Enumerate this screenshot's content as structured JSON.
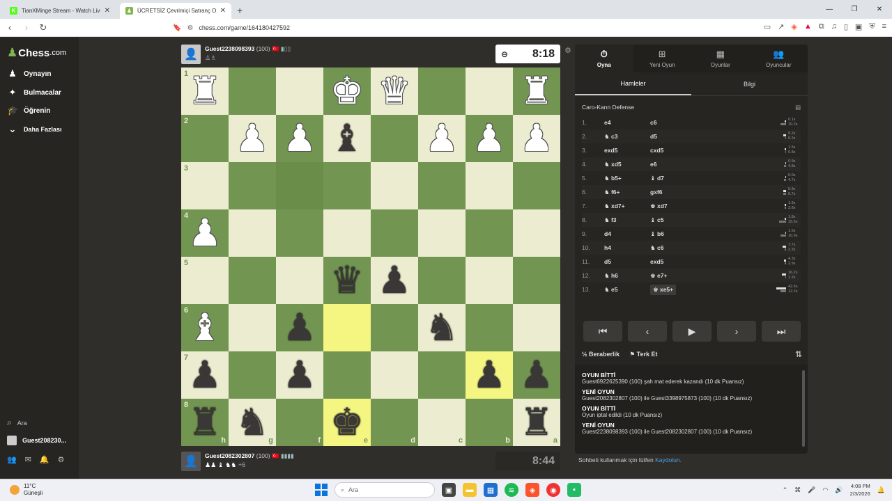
{
  "browser": {
    "tabs": [
      {
        "title": "TianXMinge Stream - Watch Live on",
        "favicon_color": "#53fc18",
        "favicon_letter": "K",
        "active": false
      },
      {
        "title": "ÜCRETSİZ Çevrimiçi Satranç Oyna",
        "favicon_color": "#81b64c",
        "favicon_letter": "♟",
        "active": true
      }
    ],
    "new_tab": "+",
    "url": "chess.com/game/164180427592"
  },
  "sidebar": {
    "logo": "Chess",
    "logo_suffix": ".com",
    "items": [
      {
        "label": "Oynayın",
        "icon": "play-icon",
        "glyph": "♟"
      },
      {
        "label": "Bulmacalar",
        "icon": "puzzle-icon",
        "glyph": "✦"
      },
      {
        "label": "Öğrenin",
        "icon": "learn-icon",
        "glyph": "🎓"
      },
      {
        "label": "Daha Fazlası",
        "icon": "chevron-down-icon",
        "glyph": "⌄"
      }
    ],
    "search_label": "Ara",
    "user_label": "Guest208230..."
  },
  "top_player": {
    "name": "Guest2238098393",
    "rating": "(100)",
    "clock": "8:18"
  },
  "bottom_player": {
    "name": "Guest2082302807",
    "rating": "(100)",
    "captures_extra": "+6",
    "clock": "8:44"
  },
  "board": {
    "ranks": [
      "1",
      "2",
      "3",
      "4",
      "5",
      "6",
      "7",
      "8"
    ],
    "files": [
      "h",
      "g",
      "f",
      "e",
      "d",
      "c",
      "b",
      "a"
    ],
    "rows": [
      [
        "wR",
        "",
        "",
        "wK",
        "wQ",
        "",
        "",
        "wR"
      ],
      [
        "",
        "wP",
        "wP",
        "bB",
        "",
        "wP",
        "wP",
        "wP"
      ],
      [
        "",
        "",
        "",
        "",
        "",
        "",
        "",
        ""
      ],
      [
        "wP",
        "",
        "",
        "",
        "",
        "",
        "",
        ""
      ],
      [
        "",
        "",
        "",
        "bQ",
        "bP",
        "",
        "",
        ""
      ],
      [
        "wB",
        "",
        "bP",
        "",
        "",
        "bN",
        "",
        ""
      ],
      [
        "bP",
        "",
        "bP",
        "",
        "",
        "",
        "bP",
        "bP"
      ],
      [
        "bR",
        "bN",
        "",
        "bK",
        "",
        "",
        "",
        "bR"
      ]
    ],
    "highlights": [
      "5-3",
      "6-6",
      "7-3"
    ],
    "selected": [
      "2-2"
    ]
  },
  "panel": {
    "tabs": [
      {
        "label": "Oyna",
        "icon": "stopwatch-icon",
        "glyph": "⏱"
      },
      {
        "label": "Yeni Oyun",
        "icon": "plus-icon",
        "glyph": "⊞"
      },
      {
        "label": "Oyunlar",
        "icon": "board-icon",
        "glyph": "▦"
      },
      {
        "label": "Oyuncular",
        "icon": "players-icon",
        "glyph": "👥"
      }
    ],
    "subtabs": [
      "Hamleler",
      "Bilgi"
    ],
    "opening": "Caro-Kann Defense",
    "moves": [
      {
        "n": "1.",
        "w": "e4",
        "b": "c6",
        "wt": "0.1s",
        "bt": "10.2s",
        "wbar": 2,
        "bbar": 8
      },
      {
        "n": "2.",
        "w": "♞ c3",
        "b": "d5",
        "wt": "5.2s",
        "bt": "0.2s",
        "wbar": 4,
        "bbar": 1
      },
      {
        "n": "3.",
        "w": "exd5",
        "b": "cxd5",
        "wt": "1.5s",
        "bt": "0.8s",
        "wbar": 2,
        "bbar": 1
      },
      {
        "n": "4.",
        "w": "♞ xd5",
        "b": "e6",
        "wt": "0.9s",
        "bt": "4.8s",
        "wbar": 1,
        "bbar": 3
      },
      {
        "n": "5.",
        "w": "♞ b5+",
        "b": "♝ d7",
        "wt": "0.0s",
        "bt": "4.7s",
        "wbar": 1,
        "bbar": 3
      },
      {
        "n": "6.",
        "w": "♞ f6+",
        "b": "gxf6",
        "wt": "5.9s",
        "bt": "6.7s",
        "wbar": 4,
        "bbar": 4
      },
      {
        "n": "7.",
        "w": "♞ xd7+",
        "b": "♚ xd7",
        "wt": "1.9s",
        "bt": "2.8s",
        "wbar": 2,
        "bbar": 2
      },
      {
        "n": "8.",
        "w": "♞ f3",
        "b": "♝ c5",
        "wt": "1.8s",
        "bt": "15.5s",
        "wbar": 2,
        "bbar": 10
      },
      {
        "n": "9.",
        "w": "d4",
        "b": "♝ b6",
        "wt": "1.0s",
        "bt": "10.9s",
        "wbar": 1,
        "bbar": 8
      },
      {
        "n": "10.",
        "w": "h4",
        "b": "♞ c6",
        "wt": "7.7s",
        "bt": "2.3s",
        "wbar": 5,
        "bbar": 2
      },
      {
        "n": "11.",
        "w": "d5",
        "b": "exd5",
        "wt": "4.3s",
        "bt": "2.9s",
        "wbar": 3,
        "bbar": 2
      },
      {
        "n": "12.",
        "w": "♞ h6",
        "b": "♚ e7+",
        "wt": "16.2s",
        "bt": "1.2s",
        "wbar": 6,
        "bbar": 1
      },
      {
        "n": "13.",
        "w": "♞ e5",
        "b": "♚ xe5+",
        "wt": "42.5s",
        "bt": "12.2s",
        "wbar": 14,
        "bbar": 8
      }
    ],
    "controls": [
      "⏮",
      "‹",
      "▶",
      "›",
      "⏭"
    ],
    "draw_label": "Beraberlik",
    "draw_prefix": "½",
    "resign_label": "Terk Et",
    "chat": [
      {
        "heading": "OYUN BİTTİ",
        "text": "Guest6922625390 (100) şah mat ederek kazandı (10 dk Puansız)"
      },
      {
        "heading": "YENİ OYUN",
        "text": "Guest2082302807 (100) ile Guest3398975873 (100) (10 dk Puansız)"
      },
      {
        "heading": "OYUN BİTTİ",
        "text": "Oyun iptal edildi (10 dk Puansız)"
      },
      {
        "heading": "YENİ OYUN",
        "text": "Guest2238098393 (100) ile Guest2082302807 (100) (10 dk Puansız)"
      }
    ],
    "chat_footer": "Sohbeti kullanmak için lütfen",
    "chat_footer_link": "Kaydolun."
  },
  "taskbar": {
    "temp": "11°C",
    "weather": "Güneşli",
    "search": "Ara",
    "time": "4:08 PM",
    "date": "2/3/2026"
  }
}
